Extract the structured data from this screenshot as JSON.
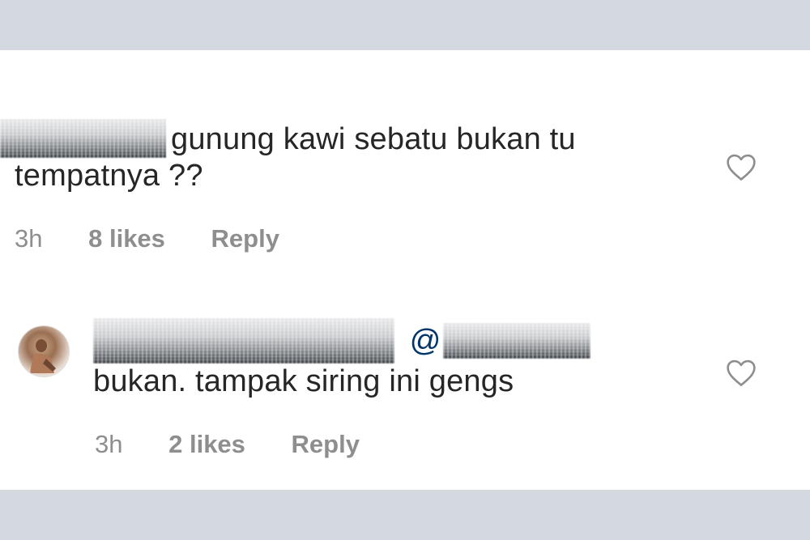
{
  "comments": [
    {
      "text_line1": "gunung kawi sebatu bukan tu",
      "text_line2": "tempatnya ??",
      "time": "3h",
      "likes": "8 likes",
      "reply_label": "Reply"
    },
    {
      "mention_symbol": "@",
      "text": "bukan. tampak siring ini gengs",
      "time": "3h",
      "likes": "2 likes",
      "reply_label": "Reply"
    }
  ],
  "icons": {
    "like": "heart-outline-icon",
    "avatar": "user-avatar"
  },
  "colors": {
    "page_bg": "#d4d8df",
    "panel_bg": "#ffffff",
    "text": "#262626",
    "meta": "#8e8e8e",
    "mention": "#003569"
  }
}
